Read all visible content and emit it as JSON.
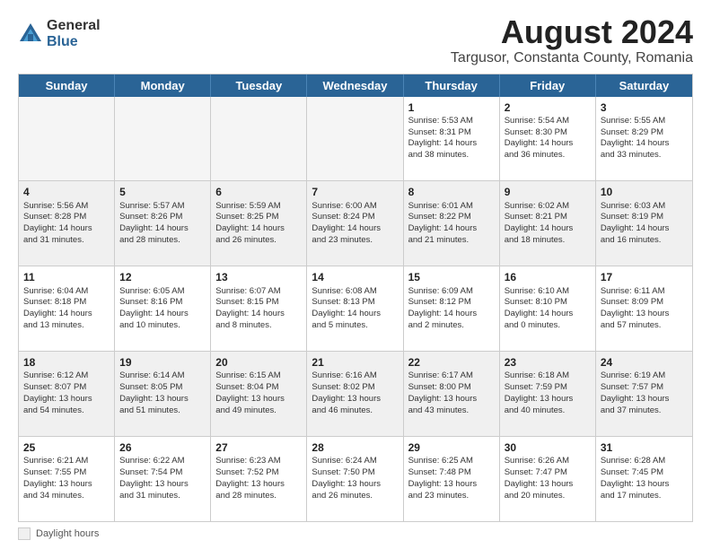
{
  "logo": {
    "general": "General",
    "blue": "Blue"
  },
  "title": "August 2024",
  "subtitle": "Targusor, Constanta County, Romania",
  "days": [
    "Sunday",
    "Monday",
    "Tuesday",
    "Wednesday",
    "Thursday",
    "Friday",
    "Saturday"
  ],
  "footer": {
    "label": "Daylight hours"
  },
  "weeks": [
    [
      {
        "day": "",
        "empty": true
      },
      {
        "day": "",
        "empty": true
      },
      {
        "day": "",
        "empty": true
      },
      {
        "day": "",
        "empty": true
      },
      {
        "day": "1",
        "lines": [
          "Sunrise: 5:53 AM",
          "Sunset: 8:31 PM",
          "Daylight: 14 hours",
          "and 38 minutes."
        ]
      },
      {
        "day": "2",
        "lines": [
          "Sunrise: 5:54 AM",
          "Sunset: 8:30 PM",
          "Daylight: 14 hours",
          "and 36 minutes."
        ]
      },
      {
        "day": "3",
        "lines": [
          "Sunrise: 5:55 AM",
          "Sunset: 8:29 PM",
          "Daylight: 14 hours",
          "and 33 minutes."
        ]
      }
    ],
    [
      {
        "day": "4",
        "lines": [
          "Sunrise: 5:56 AM",
          "Sunset: 8:28 PM",
          "Daylight: 14 hours",
          "and 31 minutes."
        ]
      },
      {
        "day": "5",
        "lines": [
          "Sunrise: 5:57 AM",
          "Sunset: 8:26 PM",
          "Daylight: 14 hours",
          "and 28 minutes."
        ]
      },
      {
        "day": "6",
        "lines": [
          "Sunrise: 5:59 AM",
          "Sunset: 8:25 PM",
          "Daylight: 14 hours",
          "and 26 minutes."
        ]
      },
      {
        "day": "7",
        "lines": [
          "Sunrise: 6:00 AM",
          "Sunset: 8:24 PM",
          "Daylight: 14 hours",
          "and 23 minutes."
        ]
      },
      {
        "day": "8",
        "lines": [
          "Sunrise: 6:01 AM",
          "Sunset: 8:22 PM",
          "Daylight: 14 hours",
          "and 21 minutes."
        ]
      },
      {
        "day": "9",
        "lines": [
          "Sunrise: 6:02 AM",
          "Sunset: 8:21 PM",
          "Daylight: 14 hours",
          "and 18 minutes."
        ]
      },
      {
        "day": "10",
        "lines": [
          "Sunrise: 6:03 AM",
          "Sunset: 8:19 PM",
          "Daylight: 14 hours",
          "and 16 minutes."
        ]
      }
    ],
    [
      {
        "day": "11",
        "lines": [
          "Sunrise: 6:04 AM",
          "Sunset: 8:18 PM",
          "Daylight: 14 hours",
          "and 13 minutes."
        ]
      },
      {
        "day": "12",
        "lines": [
          "Sunrise: 6:05 AM",
          "Sunset: 8:16 PM",
          "Daylight: 14 hours",
          "and 10 minutes."
        ]
      },
      {
        "day": "13",
        "lines": [
          "Sunrise: 6:07 AM",
          "Sunset: 8:15 PM",
          "Daylight: 14 hours",
          "and 8 minutes."
        ]
      },
      {
        "day": "14",
        "lines": [
          "Sunrise: 6:08 AM",
          "Sunset: 8:13 PM",
          "Daylight: 14 hours",
          "and 5 minutes."
        ]
      },
      {
        "day": "15",
        "lines": [
          "Sunrise: 6:09 AM",
          "Sunset: 8:12 PM",
          "Daylight: 14 hours",
          "and 2 minutes."
        ]
      },
      {
        "day": "16",
        "lines": [
          "Sunrise: 6:10 AM",
          "Sunset: 8:10 PM",
          "Daylight: 14 hours",
          "and 0 minutes."
        ]
      },
      {
        "day": "17",
        "lines": [
          "Sunrise: 6:11 AM",
          "Sunset: 8:09 PM",
          "Daylight: 13 hours",
          "and 57 minutes."
        ]
      }
    ],
    [
      {
        "day": "18",
        "lines": [
          "Sunrise: 6:12 AM",
          "Sunset: 8:07 PM",
          "Daylight: 13 hours",
          "and 54 minutes."
        ]
      },
      {
        "day": "19",
        "lines": [
          "Sunrise: 6:14 AM",
          "Sunset: 8:05 PM",
          "Daylight: 13 hours",
          "and 51 minutes."
        ]
      },
      {
        "day": "20",
        "lines": [
          "Sunrise: 6:15 AM",
          "Sunset: 8:04 PM",
          "Daylight: 13 hours",
          "and 49 minutes."
        ]
      },
      {
        "day": "21",
        "lines": [
          "Sunrise: 6:16 AM",
          "Sunset: 8:02 PM",
          "Daylight: 13 hours",
          "and 46 minutes."
        ]
      },
      {
        "day": "22",
        "lines": [
          "Sunrise: 6:17 AM",
          "Sunset: 8:00 PM",
          "Daylight: 13 hours",
          "and 43 minutes."
        ]
      },
      {
        "day": "23",
        "lines": [
          "Sunrise: 6:18 AM",
          "Sunset: 7:59 PM",
          "Daylight: 13 hours",
          "and 40 minutes."
        ]
      },
      {
        "day": "24",
        "lines": [
          "Sunrise: 6:19 AM",
          "Sunset: 7:57 PM",
          "Daylight: 13 hours",
          "and 37 minutes."
        ]
      }
    ],
    [
      {
        "day": "25",
        "lines": [
          "Sunrise: 6:21 AM",
          "Sunset: 7:55 PM",
          "Daylight: 13 hours",
          "and 34 minutes."
        ]
      },
      {
        "day": "26",
        "lines": [
          "Sunrise: 6:22 AM",
          "Sunset: 7:54 PM",
          "Daylight: 13 hours",
          "and 31 minutes."
        ]
      },
      {
        "day": "27",
        "lines": [
          "Sunrise: 6:23 AM",
          "Sunset: 7:52 PM",
          "Daylight: 13 hours",
          "and 28 minutes."
        ]
      },
      {
        "day": "28",
        "lines": [
          "Sunrise: 6:24 AM",
          "Sunset: 7:50 PM",
          "Daylight: 13 hours",
          "and 26 minutes."
        ]
      },
      {
        "day": "29",
        "lines": [
          "Sunrise: 6:25 AM",
          "Sunset: 7:48 PM",
          "Daylight: 13 hours",
          "and 23 minutes."
        ]
      },
      {
        "day": "30",
        "lines": [
          "Sunrise: 6:26 AM",
          "Sunset: 7:47 PM",
          "Daylight: 13 hours",
          "and 20 minutes."
        ]
      },
      {
        "day": "31",
        "lines": [
          "Sunrise: 6:28 AM",
          "Sunset: 7:45 PM",
          "Daylight: 13 hours",
          "and 17 minutes."
        ]
      }
    ]
  ]
}
